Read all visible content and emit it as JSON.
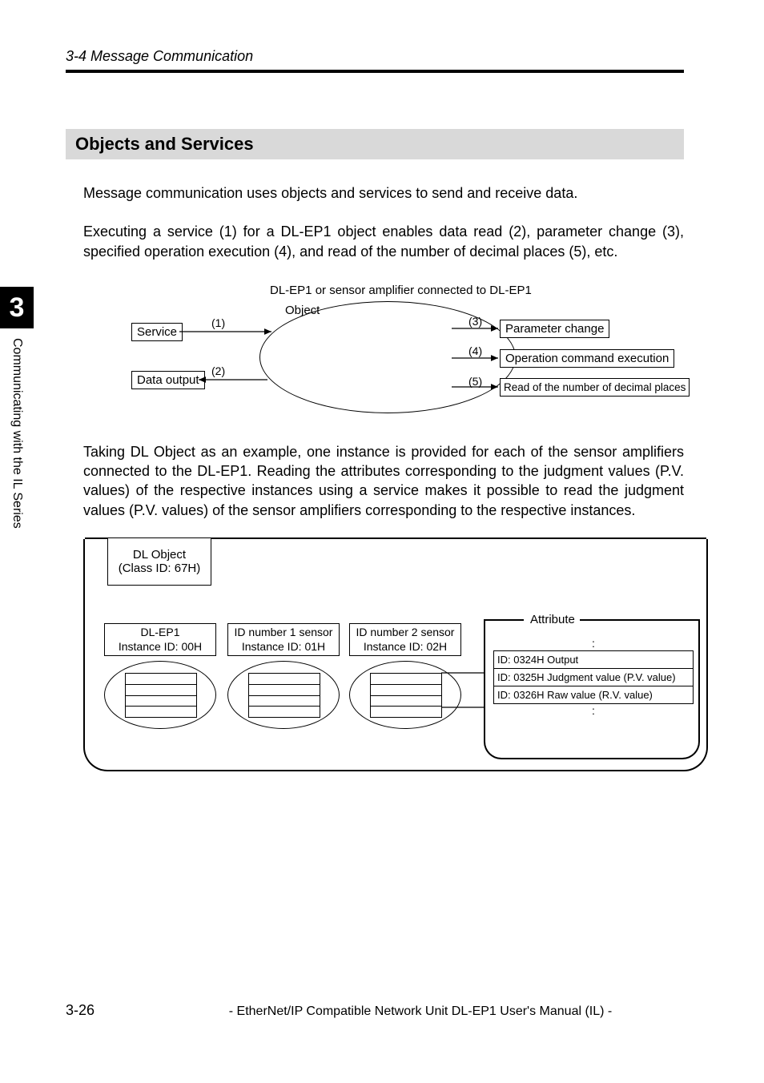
{
  "header": {
    "section": "3-4 Message Communication"
  },
  "subsection": "Objects and Services",
  "paragraphs": {
    "p1": "Message communication uses objects and services to send and receive data.",
    "p2": "Executing a service (1) for a DL-EP1 object enables data read (2), parameter change (3), specified operation execution (4), and read of the number of decimal places (5), etc.",
    "p3": "Taking DL Object as an example, one instance is provided for each of the sensor amplifiers connected to the DL-EP1. Reading the attributes corresponding to the judgment values (P.V. values) of the respective instances using a service makes it possible to read the judgment values (P.V. values) of the sensor amplifiers corresponding to the respective instances."
  },
  "sidetab": {
    "chapter": "3",
    "title": "Communicating with the IL Series"
  },
  "diagram1": {
    "caption": "DL-EP1 or sensor amplifier connected to DL-EP1",
    "object_label": "Object",
    "service": "Service",
    "data_output": "Data output",
    "param_change": "Parameter change",
    "op_cmd": "Operation command execution",
    "read_decimal": "Read of the number of decimal places",
    "n1": "(1)",
    "n2": "(2)",
    "n3": "(3)",
    "n4": "(4)",
    "n5": "(5)"
  },
  "diagram2": {
    "class_line1": "DL Object",
    "class_line2": "(Class ID: 67H)",
    "inst1_l1": "DL-EP1",
    "inst1_l2": "Instance ID: 00H",
    "inst2_l1": "ID number 1 sensor",
    "inst2_l2": "Instance ID: 01H",
    "inst3_l1": "ID number 2 sensor",
    "inst3_l2": "Instance ID: 02H",
    "attr_title": "Attribute",
    "attr_rows": {
      "r1": "ID: 0324H Output",
      "r2": "ID: 0325H Judgment value (P.V. value)",
      "r3": "ID: 0326H Raw value (R.V. value)"
    },
    "dots": ":"
  },
  "footer": {
    "page": "3-26",
    "title": "- EtherNet/IP Compatible Network Unit DL-EP1 User's Manual (IL) -"
  }
}
